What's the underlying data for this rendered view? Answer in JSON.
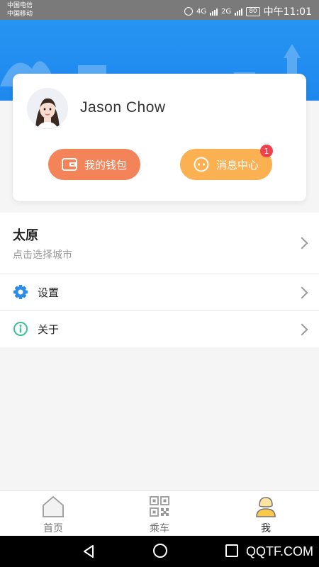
{
  "status_bar": {
    "carrier_1": "中国电信",
    "carrier_2": "中国移动",
    "network_1": "4G",
    "network_2": "2G",
    "battery": "80",
    "time": "中午11:01"
  },
  "profile": {
    "username": "Jason Chow",
    "wallet_label": "我的钱包",
    "message_label": "消息中心",
    "message_badge": "1"
  },
  "city": {
    "name": "太原",
    "hint": "点击选择城市"
  },
  "menu": {
    "items": [
      {
        "label": "设置",
        "icon": "gear-icon"
      },
      {
        "label": "关于",
        "icon": "info-icon"
      }
    ]
  },
  "tabs": [
    {
      "label": "首页",
      "icon": "home-icon",
      "active": false
    },
    {
      "label": "乘车",
      "icon": "qr-code-icon",
      "active": false
    },
    {
      "label": "我",
      "icon": "person-icon",
      "active": true
    }
  ],
  "watermark": "QQTF.COM",
  "colors": {
    "header_blue": "#2694f2",
    "wallet_orange": "#f38358",
    "message_yellow": "#fbb052",
    "badge_red": "#f0414e",
    "gear_blue": "#2b8de8",
    "info_green": "#3cbf9a"
  }
}
